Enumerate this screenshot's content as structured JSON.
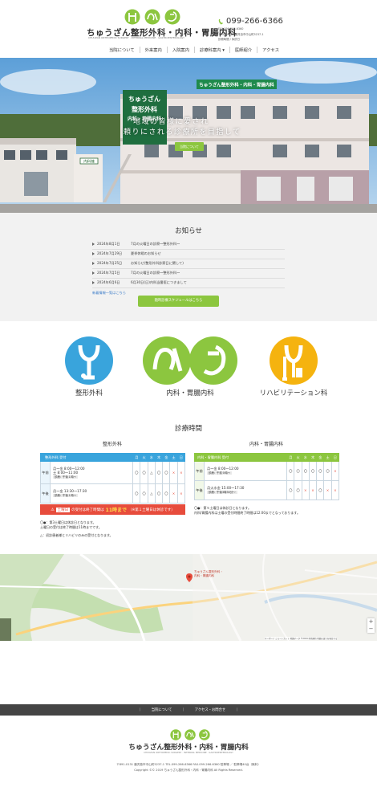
{
  "header": {
    "clinic_name": "ちゅうざん整形外科・内科・胃腸内科",
    "clinic_name_sub": "CHUUZAN ORTHOPEDIC SURGERY · INTERNAL MEDICINE · GASTROENTEROLOGY",
    "phone": "099-266-6366",
    "fax": "FAX.099-266-6360",
    "address": "〒891-0131 鹿児島市中山町5237-1",
    "hours_note": "診療時間 / 休診日"
  },
  "nav": {
    "items": [
      {
        "label": "当院について"
      },
      {
        "label": "外来案内"
      },
      {
        "label": "入院案内"
      },
      {
        "label": "診療科案内 ▾"
      },
      {
        "label": "医師紹介"
      },
      {
        "label": "アクセス"
      }
    ]
  },
  "hero": {
    "line1": "地域の皆様に愛され",
    "line2": "頼りにされる診療所を目指して",
    "button": "当院について",
    "sign": "ちゅうざん整形外科・内科・胃腸内科",
    "tower_sign": [
      "ちゅうざん",
      "整形外科",
      "内科・胃腸内科"
    ],
    "side_sign": "内科棟"
  },
  "news": {
    "title": "お知らせ",
    "items": [
      {
        "date": "2024年8月1日",
        "text": "7月の火曜日の診察〜整形外科〜"
      },
      {
        "date": "2024年7月29日",
        "text": "夏季休暇のお知らせ"
      },
      {
        "date": "2024年7月25日",
        "text": "お知らせ(整形外科診察日に関して)"
      },
      {
        "date": "2024年7月5日",
        "text": "7月の火曜日の診察〜整形外科〜"
      },
      {
        "date": "2024年6月6日",
        "text": "6月30日(日)内科当番医につきまして"
      }
    ],
    "more": "新着情報一覧はこちら",
    "schedule_button": "随時診療スケジュールはこちら"
  },
  "departments": [
    {
      "label": "整形外科",
      "color": "#39a4dc"
    },
    {
      "label": "内科・胃腸内科",
      "color": "#8cc63f"
    },
    {
      "label": "リハビリテーション科",
      "color": "#f5b30f"
    }
  ],
  "hours": {
    "title": "診療時間",
    "ortho": {
      "subtitle": "整形外科",
      "header": [
        "整形外科 受付",
        "月",
        "火",
        "水",
        "木",
        "金",
        "土",
        "日"
      ],
      "rows": [
        {
          "period": "午前",
          "time": "月〜金 8:00〜12:00\n土 8:00〜11:00",
          "tag": "診療：午後１時〜",
          "marks": [
            "〇",
            "〇",
            "△",
            "〇",
            "〇",
            "×",
            "×"
          ]
        },
        {
          "period": "午後",
          "time": "月〜金 13:30〜17:30",
          "tag": "診療：午後１時〜",
          "marks": [
            "〇",
            "〇",
            "△",
            "〇",
            "〇",
            "×",
            "×"
          ]
        }
      ],
      "alert_prefix": "土曜日",
      "alert_text": "の受付は終了時間は",
      "alert_time": "11時まで",
      "alert_suffix": "（※第１土曜日は休診です）",
      "notes": [
        "〇●：第3土曜日は休診日となります。",
        "土曜日の受付は終了時間は11時までです。",
        "△：初診患者様とリハビリのみの受付となります。"
      ]
    },
    "internal": {
      "subtitle": "内科・胃腸内科",
      "header": [
        "内科・胃腸内科 受付",
        "月",
        "火",
        "水",
        "木",
        "金",
        "土",
        "日"
      ],
      "rows": [
        {
          "period": "午前",
          "time": "月〜金 8:00〜12:00",
          "tag": "診療：午前９時〜",
          "marks": [
            "〇",
            "〇",
            "〇",
            "〇",
            "〇",
            "〇",
            "×"
          ]
        },
        {
          "period": "午後",
          "time": "月火水金 15:00〜17:30",
          "tag": "診療：午後3時30分〜",
          "marks": [
            "〇",
            "〇",
            "×",
            "×",
            "〇",
            "×",
            "×"
          ]
        }
      ],
      "notes": [
        "〇●：第５土曜日は休診日となります。",
        "内科/胃腸内科は土曜の受付時間終了時間は12:00までとなっております。"
      ]
    }
  },
  "map": {
    "marker_label": "ちゅうざん整形外科・内科・胃腸内科",
    "attribution": "キーボード ショートカット  地図データ ©2024  利用規約  地図の誤りを報告する"
  },
  "footer": {
    "links": [
      "｜",
      "当院について",
      "｜",
      "アクセス・お問合せ",
      "｜"
    ],
    "clinic_name": "ちゅうざん整形外科・内科・胃腸内科",
    "clinic_name_sub": "CHUUZAN ORTHOPEDIC SURGERY · INTERNAL MEDICINE · GASTROENTEROLOGY",
    "address": "〒891-0131 鹿児島市中山町5237-1 TEL.099-266-6366  FAX.099-266-6360  駐車場 ／ 駐車場40台（無料）",
    "copyright": "Copyright ©© 2019 ちゅうざん整形外科・内科・胃腸内科 All Rights Reserved."
  },
  "colors": {
    "green": "#8cc63f",
    "blue": "#39a4dc",
    "orange": "#f5b30f",
    "red": "#e74c3c"
  }
}
